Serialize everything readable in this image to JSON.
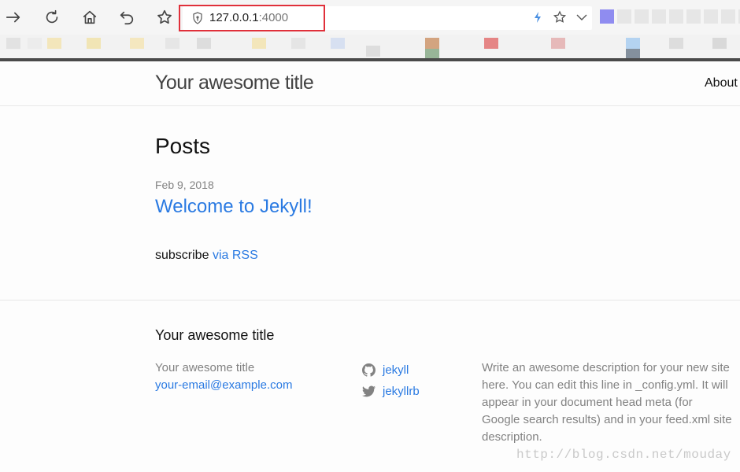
{
  "browser": {
    "url_host": "127.0.0.1",
    "url_port": ":4000",
    "icons": [
      "forward-icon",
      "reload-icon",
      "home-icon",
      "undo-icon",
      "star-icon",
      "shield-icon",
      "lightning-icon",
      "star-icon",
      "chevron-down-icon"
    ]
  },
  "header": {
    "site_title": "Your awesome title",
    "nav": [
      {
        "label": "About"
      }
    ]
  },
  "main": {
    "heading": "Posts",
    "posts": [
      {
        "date": "Feb 9, 2018",
        "title": "Welcome to Jekyll!"
      }
    ],
    "subscribe_text": "subscribe",
    "subscribe_link": "via RSS"
  },
  "footer": {
    "heading": "Your awesome title",
    "name": "Your awesome title",
    "email": "your-email@example.com",
    "social": [
      {
        "label": "jekyll",
        "icon": "github-icon"
      },
      {
        "label": "jekyllrb",
        "icon": "twitter-icon"
      }
    ],
    "description": "Write an awesome description for your new site here. You can edit this line in _config.yml. It will appear in your document head meta (for Google search results) and in your feed.xml site description."
  },
  "watermark": "http://blog.csdn.net/mouday",
  "colors": {
    "link": "#2a7ae2",
    "muted": "#828282",
    "highlight": "#e0303a"
  }
}
